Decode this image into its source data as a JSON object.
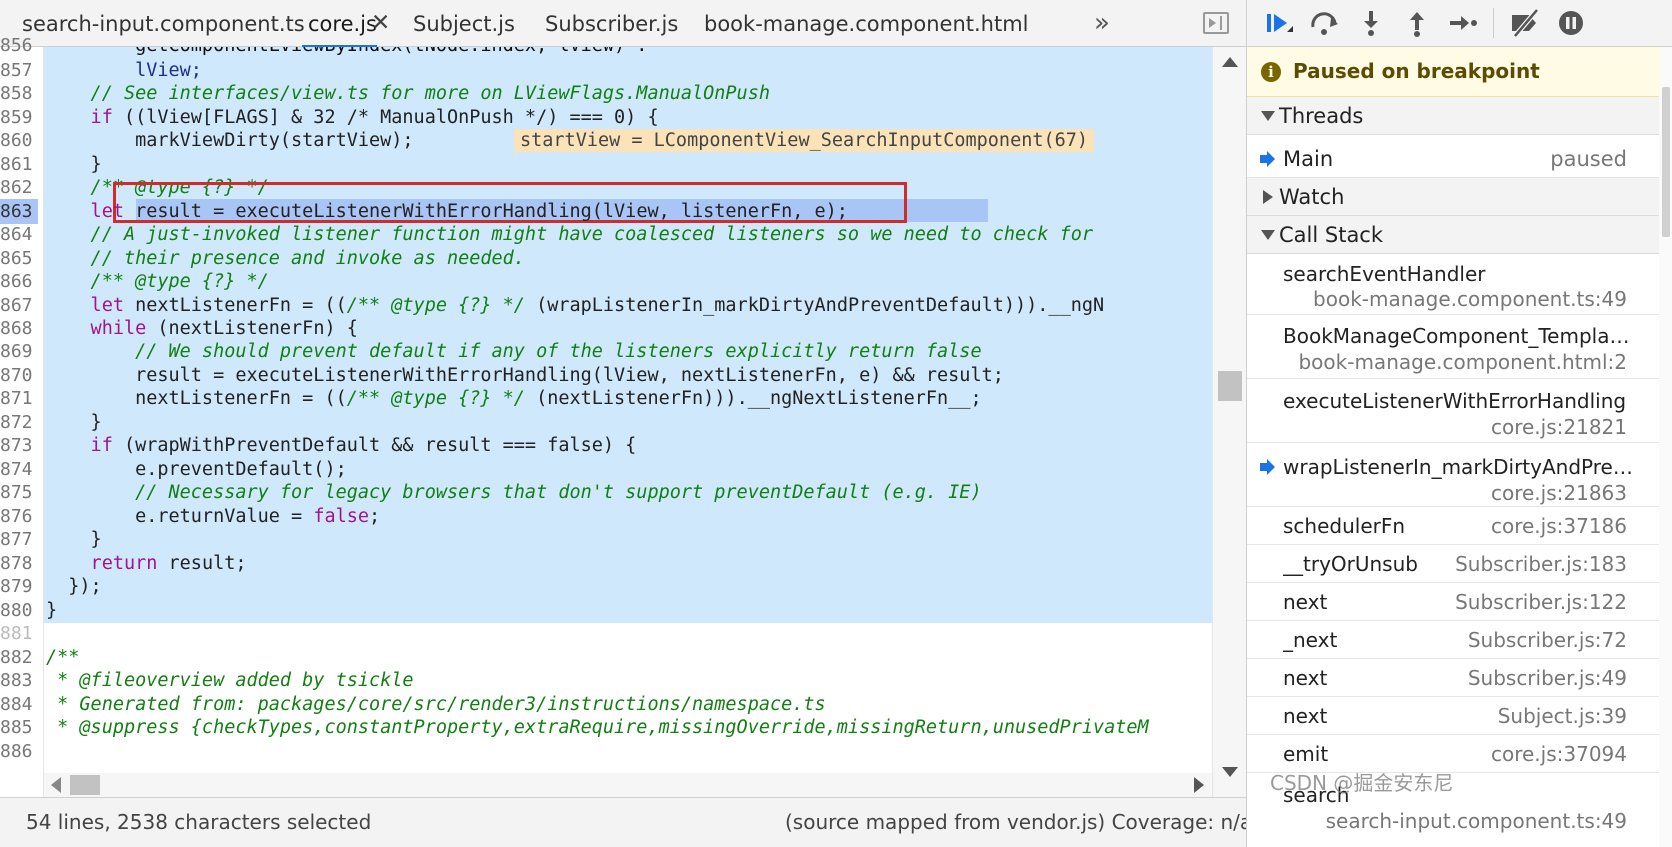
{
  "tabs": [
    {
      "label": "search-input.component.ts",
      "active": false
    },
    {
      "label": "core.js",
      "active": true
    },
    {
      "label": "Subject.js",
      "active": false
    },
    {
      "label": "Subscriber.js",
      "active": false
    },
    {
      "label": "book-manage.component.html",
      "active": false
    }
  ],
  "tab_overflow_glyph": "»",
  "tab_close_glyph": "✕",
  "gutter": [
    "856",
    "857",
    "858",
    "859",
    "860",
    "861",
    "862",
    "863",
    "864",
    "865",
    "866",
    "867",
    "868",
    "869",
    "870",
    "871",
    "872",
    "873",
    "874",
    "875",
    "876",
    "877",
    "878",
    "879",
    "880",
    "881",
    "882",
    "883",
    "884",
    "885",
    "886"
  ],
  "code": {
    "l856": "        getComponentLViewByIndex(tNode.index, lView) :",
    "l857a": "        lView;",
    "l858": "    // See interfaces/view.ts for more on LViewFlags.ManualOnPush",
    "l859_if": "    if",
    "l859_rest": " ((lView[FLAGS] & 32 /* ManualOnPush */) === 0) {",
    "l860": "        markViewDirty(startView);",
    "l860_inline": "startView = LComponentView_SearchInputComponent(67)",
    "l861": "    }",
    "l862": "    /** @type {?} */",
    "l863_let": "    let",
    "l863_rest": " result = executeListenerWithErrorHandling(lView, listenerFn, e);",
    "l864": "    // A just-invoked listener function might have coalesced listeners so we need to check for",
    "l865": "    // their presence and invoke as needed.",
    "l866": "    /** @type {?} */",
    "l867_let": "    let",
    "l867_a": " nextListenerFn = ((",
    "l867_cmt": "/** @type {?} */",
    "l867_b": " (wrapListenerIn_markDirtyAndPreventDefault))).__ngN",
    "l868_kw": "    while",
    "l868_rest": " (nextListenerFn) {",
    "l869": "        // We should prevent default if any of the listeners explicitly return false",
    "l870": "        result = executeListenerWithErrorHandling(lView, nextListenerFn, e) && result;",
    "l871_a": "        nextListenerFn = ((",
    "l871_cmt": "/** @type {?} */",
    "l871_b": " (nextListenerFn))).__ngNextListenerFn__;",
    "l872": "    }",
    "l873_if": "    if",
    "l873_rest": " (wrapWithPreventDefault && result === false) {",
    "l874": "        e.preventDefault();",
    "l875": "        // Necessary for legacy browsers that don't support preventDefault (e.g. IE)",
    "l876_a": "        e.returnValue = ",
    "l876_false": "false",
    "l876_b": ";",
    "l877": "    }",
    "l878_kw": "    return",
    "l878_rest": " result;",
    "l879": "  });",
    "l880": "}",
    "l881": "",
    "l882": "/**",
    "l883": " * @fileoverview added by tsickle",
    "l884": " * Generated from: packages/core/src/render3/instructions/namespace.ts",
    "l885": " * @suppress {checkTypes,constantProperty,extraRequire,missingOverride,missingReturn,unusedPrivateM",
    "l886": ""
  },
  "status": {
    "left": "54 lines, 2538 characters selected",
    "right": "(source mapped from vendor.js)  Coverage: n/a"
  },
  "debugger": {
    "paused_text": "Paused on breakpoint",
    "paused_icon": "i",
    "sections": {
      "threads": "Threads",
      "watch": "Watch",
      "call_stack": "Call Stack"
    },
    "threads": [
      {
        "name": "Main",
        "status": "paused"
      }
    ],
    "call_stack": [
      {
        "name": "searchEventHandler",
        "location": "book-manage.component.ts:49",
        "two_line": true,
        "current": false
      },
      {
        "name": "BookManageComponent_Template_a...",
        "location": "book-manage.component.html:2",
        "two_line": true,
        "current": false
      },
      {
        "name": "executeListenerWithErrorHandling",
        "location": "core.js:21821",
        "two_line": true,
        "current": false
      },
      {
        "name": "wrapListenerIn_markDirtyAndPrevent...",
        "location": "core.js:21863",
        "two_line": true,
        "current": true
      },
      {
        "name": "schedulerFn",
        "location": "core.js:37186",
        "two_line": false,
        "current": false
      },
      {
        "name": "__tryOrUnsub",
        "location": "Subscriber.js:183",
        "two_line": false,
        "current": false
      },
      {
        "name": "next",
        "location": "Subscriber.js:122",
        "two_line": false,
        "current": false
      },
      {
        "name": "_next",
        "location": "Subscriber.js:72",
        "two_line": false,
        "current": false
      },
      {
        "name": "next",
        "location": "Subscriber.js:49",
        "two_line": false,
        "current": false
      },
      {
        "name": "next",
        "location": "Subject.js:39",
        "two_line": false,
        "current": false
      },
      {
        "name": "emit",
        "location": "core.js:37094",
        "two_line": false,
        "current": false
      },
      {
        "name": "search",
        "location": "search-input.component.ts:49",
        "two_line": true,
        "current": false
      }
    ]
  },
  "watermark": "CSDN @掘金安东尼",
  "colors": {
    "selection": "#cfe8fc",
    "exec_line": "#a9c5f5",
    "breakpoint_box": "#d32a2a",
    "accent": "#1a73e8"
  }
}
